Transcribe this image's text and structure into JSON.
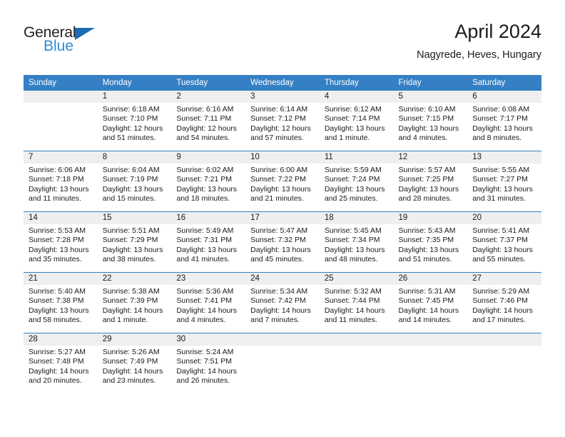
{
  "brand": {
    "name_top": "General",
    "name_bottom": "Blue",
    "accent_color": "#2e8ad4",
    "triangle_color": "#1b6cb5"
  },
  "header": {
    "title": "April 2024",
    "subtitle": "Nagyrede, Heves, Hungary"
  },
  "theme": {
    "header_band": "#3580c4",
    "daynum_band": "#efefef",
    "grid_line": "#3580c4"
  },
  "weekdays": [
    "Sunday",
    "Monday",
    "Tuesday",
    "Wednesday",
    "Thursday",
    "Friday",
    "Saturday"
  ],
  "weeks": [
    [
      {
        "day": "",
        "lines": [
          "",
          "",
          "",
          ""
        ]
      },
      {
        "day": "1",
        "lines": [
          "Sunrise: 6:18 AM",
          "Sunset: 7:10 PM",
          "Daylight: 12 hours",
          "and 51 minutes."
        ]
      },
      {
        "day": "2",
        "lines": [
          "Sunrise: 6:16 AM",
          "Sunset: 7:11 PM",
          "Daylight: 12 hours",
          "and 54 minutes."
        ]
      },
      {
        "day": "3",
        "lines": [
          "Sunrise: 6:14 AM",
          "Sunset: 7:12 PM",
          "Daylight: 12 hours",
          "and 57 minutes."
        ]
      },
      {
        "day": "4",
        "lines": [
          "Sunrise: 6:12 AM",
          "Sunset: 7:14 PM",
          "Daylight: 13 hours",
          "and 1 minute."
        ]
      },
      {
        "day": "5",
        "lines": [
          "Sunrise: 6:10 AM",
          "Sunset: 7:15 PM",
          "Daylight: 13 hours",
          "and 4 minutes."
        ]
      },
      {
        "day": "6",
        "lines": [
          "Sunrise: 6:08 AM",
          "Sunset: 7:17 PM",
          "Daylight: 13 hours",
          "and 8 minutes."
        ]
      }
    ],
    [
      {
        "day": "7",
        "lines": [
          "Sunrise: 6:06 AM",
          "Sunset: 7:18 PM",
          "Daylight: 13 hours",
          "and 11 minutes."
        ]
      },
      {
        "day": "8",
        "lines": [
          "Sunrise: 6:04 AM",
          "Sunset: 7:19 PM",
          "Daylight: 13 hours",
          "and 15 minutes."
        ]
      },
      {
        "day": "9",
        "lines": [
          "Sunrise: 6:02 AM",
          "Sunset: 7:21 PM",
          "Daylight: 13 hours",
          "and 18 minutes."
        ]
      },
      {
        "day": "10",
        "lines": [
          "Sunrise: 6:00 AM",
          "Sunset: 7:22 PM",
          "Daylight: 13 hours",
          "and 21 minutes."
        ]
      },
      {
        "day": "11",
        "lines": [
          "Sunrise: 5:59 AM",
          "Sunset: 7:24 PM",
          "Daylight: 13 hours",
          "and 25 minutes."
        ]
      },
      {
        "day": "12",
        "lines": [
          "Sunrise: 5:57 AM",
          "Sunset: 7:25 PM",
          "Daylight: 13 hours",
          "and 28 minutes."
        ]
      },
      {
        "day": "13",
        "lines": [
          "Sunrise: 5:55 AM",
          "Sunset: 7:27 PM",
          "Daylight: 13 hours",
          "and 31 minutes."
        ]
      }
    ],
    [
      {
        "day": "14",
        "lines": [
          "Sunrise: 5:53 AM",
          "Sunset: 7:28 PM",
          "Daylight: 13 hours",
          "and 35 minutes."
        ]
      },
      {
        "day": "15",
        "lines": [
          "Sunrise: 5:51 AM",
          "Sunset: 7:29 PM",
          "Daylight: 13 hours",
          "and 38 minutes."
        ]
      },
      {
        "day": "16",
        "lines": [
          "Sunrise: 5:49 AM",
          "Sunset: 7:31 PM",
          "Daylight: 13 hours",
          "and 41 minutes."
        ]
      },
      {
        "day": "17",
        "lines": [
          "Sunrise: 5:47 AM",
          "Sunset: 7:32 PM",
          "Daylight: 13 hours",
          "and 45 minutes."
        ]
      },
      {
        "day": "18",
        "lines": [
          "Sunrise: 5:45 AM",
          "Sunset: 7:34 PM",
          "Daylight: 13 hours",
          "and 48 minutes."
        ]
      },
      {
        "day": "19",
        "lines": [
          "Sunrise: 5:43 AM",
          "Sunset: 7:35 PM",
          "Daylight: 13 hours",
          "and 51 minutes."
        ]
      },
      {
        "day": "20",
        "lines": [
          "Sunrise: 5:41 AM",
          "Sunset: 7:37 PM",
          "Daylight: 13 hours",
          "and 55 minutes."
        ]
      }
    ],
    [
      {
        "day": "21",
        "lines": [
          "Sunrise: 5:40 AM",
          "Sunset: 7:38 PM",
          "Daylight: 13 hours",
          "and 58 minutes."
        ]
      },
      {
        "day": "22",
        "lines": [
          "Sunrise: 5:38 AM",
          "Sunset: 7:39 PM",
          "Daylight: 14 hours",
          "and 1 minute."
        ]
      },
      {
        "day": "23",
        "lines": [
          "Sunrise: 5:36 AM",
          "Sunset: 7:41 PM",
          "Daylight: 14 hours",
          "and 4 minutes."
        ]
      },
      {
        "day": "24",
        "lines": [
          "Sunrise: 5:34 AM",
          "Sunset: 7:42 PM",
          "Daylight: 14 hours",
          "and 7 minutes."
        ]
      },
      {
        "day": "25",
        "lines": [
          "Sunrise: 5:32 AM",
          "Sunset: 7:44 PM",
          "Daylight: 14 hours",
          "and 11 minutes."
        ]
      },
      {
        "day": "26",
        "lines": [
          "Sunrise: 5:31 AM",
          "Sunset: 7:45 PM",
          "Daylight: 14 hours",
          "and 14 minutes."
        ]
      },
      {
        "day": "27",
        "lines": [
          "Sunrise: 5:29 AM",
          "Sunset: 7:46 PM",
          "Daylight: 14 hours",
          "and 17 minutes."
        ]
      }
    ],
    [
      {
        "day": "28",
        "lines": [
          "Sunrise: 5:27 AM",
          "Sunset: 7:48 PM",
          "Daylight: 14 hours",
          "and 20 minutes."
        ]
      },
      {
        "day": "29",
        "lines": [
          "Sunrise: 5:26 AM",
          "Sunset: 7:49 PM",
          "Daylight: 14 hours",
          "and 23 minutes."
        ]
      },
      {
        "day": "30",
        "lines": [
          "Sunrise: 5:24 AM",
          "Sunset: 7:51 PM",
          "Daylight: 14 hours",
          "and 26 minutes."
        ]
      },
      {
        "day": "",
        "lines": [
          "",
          "",
          "",
          ""
        ]
      },
      {
        "day": "",
        "lines": [
          "",
          "",
          "",
          ""
        ]
      },
      {
        "day": "",
        "lines": [
          "",
          "",
          "",
          ""
        ]
      },
      {
        "day": "",
        "lines": [
          "",
          "",
          "",
          ""
        ]
      }
    ]
  ]
}
